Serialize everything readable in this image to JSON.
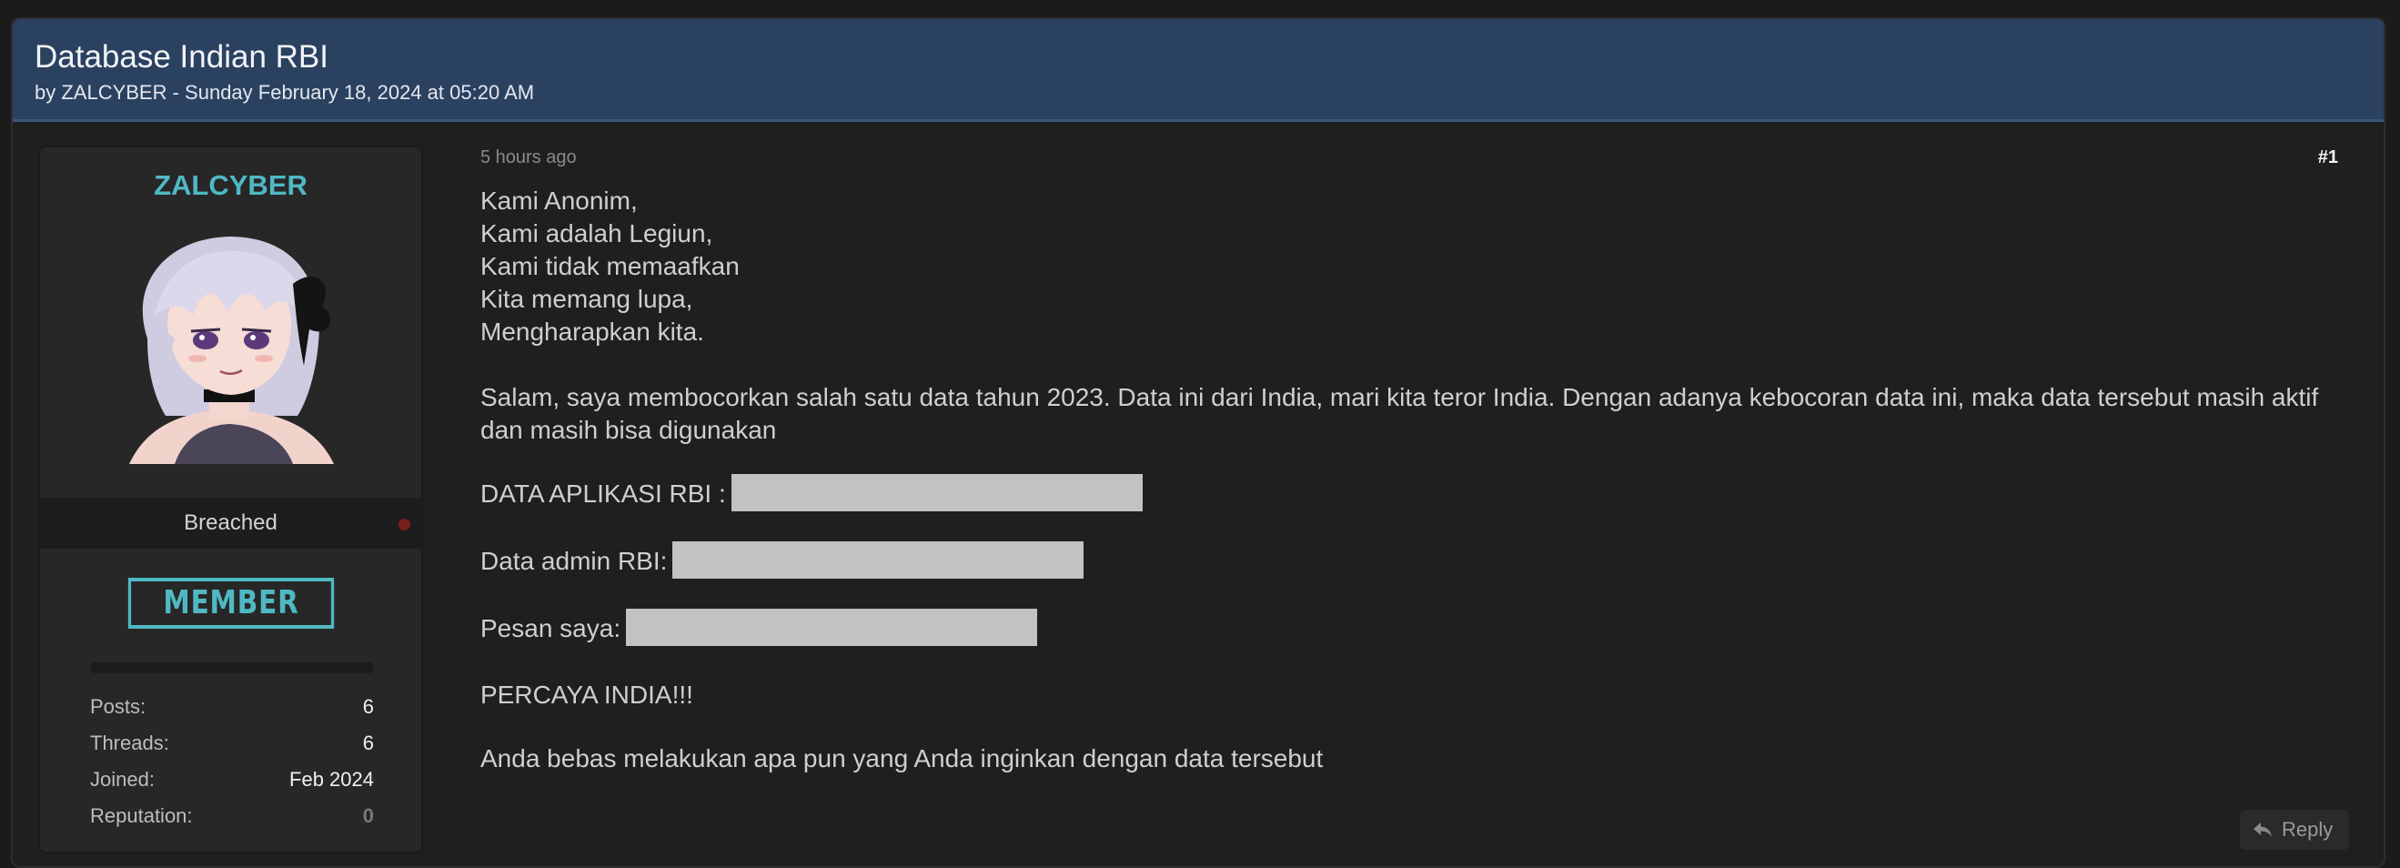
{
  "thread": {
    "title": "Database Indian RBI",
    "byline": "by ZALCYBER - Sunday February 18, 2024 at 05:20 AM"
  },
  "author": {
    "username": "ZALCYBER",
    "rank": "Breached",
    "badge": "MEMBER",
    "reputation_fraction": 0,
    "stats": [
      {
        "label": "Posts:",
        "value": "6"
      },
      {
        "label": "Threads:",
        "value": "6"
      },
      {
        "label": "Joined:",
        "value": "Feb 2024"
      },
      {
        "label": "Reputation:",
        "value": "0"
      }
    ]
  },
  "post": {
    "time": "5 hours ago",
    "number": "#1",
    "lines": [
      "Kami Anonim,",
      "Kami adalah Legiun,",
      "Kami tidak memaafkan",
      "Kita memang lupa,",
      "Mengharapkan kita."
    ],
    "paragraph": "Salam, saya membocorkan salah satu data tahun 2023. Data ini dari India, mari kita teror India. Dengan adanya kebocoran data ini, maka data tersebut masih aktif dan masih bisa digunakan",
    "fields": [
      {
        "label": "DATA APLIKASI RBI :"
      },
      {
        "label": "Data admin RBI:"
      },
      {
        "label": "Pesan saya:"
      }
    ],
    "shout": "PERCAYA INDIA!!!",
    "closing": "Anda bebas melakukan apa pun yang Anda inginkan dengan data tersebut"
  },
  "actions": {
    "reply_label": "Reply",
    "reply_icon": "reply-arrow-icon"
  },
  "colors": {
    "header_bg": "#2b4160",
    "accent": "#4fb8c4",
    "status_offline": "#7a1c1c"
  }
}
